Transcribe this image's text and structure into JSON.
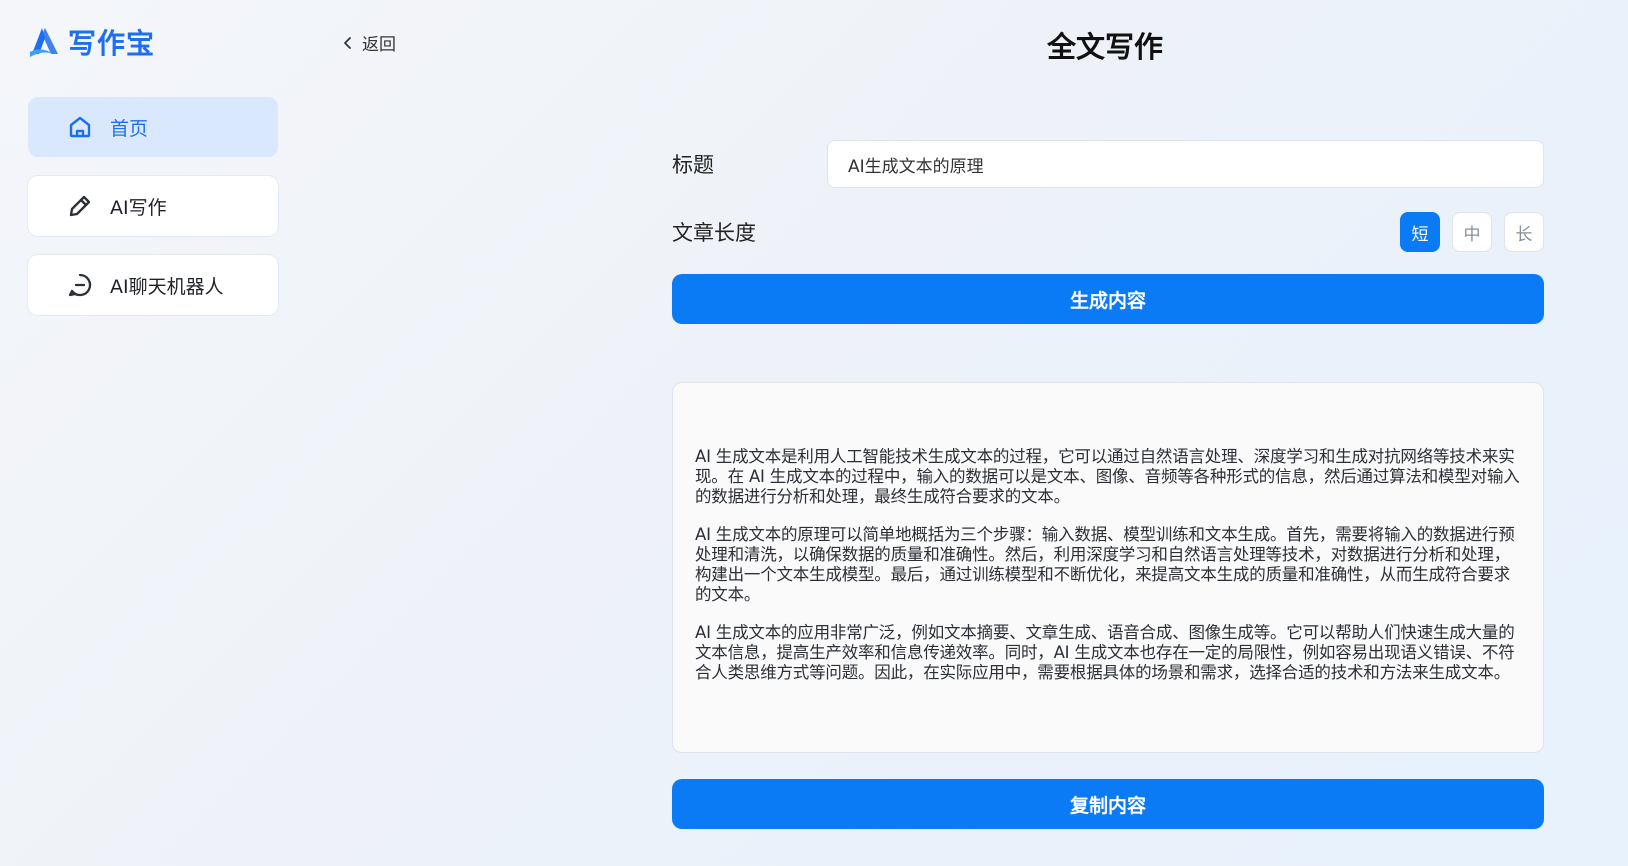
{
  "app": {
    "logo_text": "写作宝",
    "accent_color": "#0a7bf5"
  },
  "sidebar": {
    "items": [
      {
        "label": "首页",
        "icon": "home-icon",
        "active": true
      },
      {
        "label": "AI写作",
        "icon": "pencil-icon",
        "active": false
      },
      {
        "label": "AI聊天机器人",
        "icon": "chat-bubble-icon",
        "active": false
      }
    ]
  },
  "header": {
    "back_label": "返回",
    "title": "全文写作"
  },
  "form": {
    "title_label": "标题",
    "title_value": "AI生成文本的原理",
    "length_label": "文章长度",
    "length_options": [
      "短",
      "中",
      "长"
    ],
    "length_selected": "短",
    "generate_label": "生成内容"
  },
  "result": {
    "paragraphs": [
      "AI 生成文本是利用人工智能技术生成文本的过程，它可以通过自然语言处理、深度学习和生成对抗网络等技术来实现。在 AI 生成文本的过程中，输入的数据可以是文本、图像、音频等各种形式的信息，然后通过算法和模型对输入的数据进行分析和处理，最终生成符合要求的文本。",
      "AI 生成文本的原理可以简单地概括为三个步骤：输入数据、模型训练和文本生成。首先，需要将输入的数据进行预处理和清洗，以确保数据的质量和准确性。然后，利用深度学习和自然语言处理等技术，对数据进行分析和处理，构建出一个文本生成模型。最后，通过训练模型和不断优化，来提高文本生成的质量和准确性，从而生成符合要求的文本。",
      "AI 生成文本的应用非常广泛，例如文本摘要、文章生成、语音合成、图像生成等。它可以帮助人们快速生成大量的文本信息，提高生产效率和信息传递效率。同时，AI 生成文本也存在一定的局限性，例如容易出现语义错误、不符合人类思维方式等问题。因此，在实际应用中，需要根据具体的场景和需求，选择合适的技术和方法来生成文本。"
    ],
    "copy_label": "复制内容"
  }
}
